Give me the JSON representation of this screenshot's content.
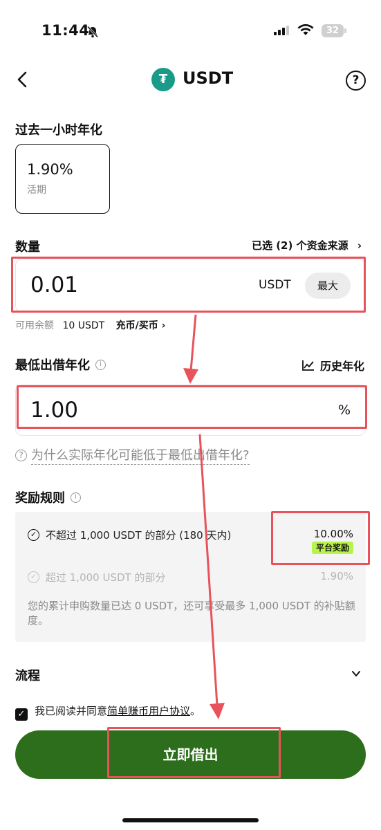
{
  "status_bar": {
    "time": "11:44",
    "battery": "32"
  },
  "header": {
    "title": "USDT",
    "coin_symbol": "₮"
  },
  "apy": {
    "label": "过去一小时年化",
    "value": "1.90%",
    "term": "活期"
  },
  "amount": {
    "label": "数量",
    "source_link": "已选 (2) 个资金来源",
    "value": "0.01",
    "unit": "USDT",
    "max_label": "最大",
    "balance_label": "可用余额",
    "balance_value": "10 USDT",
    "deposit_link": "充币/买币"
  },
  "min_rate": {
    "label": "最低出借年化",
    "history_link": "历史年化",
    "value": "1.00",
    "unit": "%",
    "why_text": "为什么实际年化可能低于最低出借年化?"
  },
  "rewards": {
    "label": "奖励规则",
    "rule1_text": "不超过 1,000 USDT 的部分 (180 天内)",
    "rule1_rate": "10.00%",
    "rule1_badge": "平台奖励",
    "rule2_text": "超过 1,000 USDT 的部分",
    "rule2_rate": "1.90%",
    "note": "您的累计申购数量已达 0 USDT，还可享受最多 1,000 USDT 的补贴额度。"
  },
  "flow": {
    "label": "流程"
  },
  "agreement": {
    "prefix": "我已阅读并同意",
    "link": "简单赚币用户协议",
    "suffix": "。"
  },
  "submit_label": "立即借出",
  "colors": {
    "accent_green": "#2d6e1c",
    "badge_green": "#b7f44b",
    "annotation_red": "#e8525b",
    "coin_teal": "#1a9b89"
  }
}
